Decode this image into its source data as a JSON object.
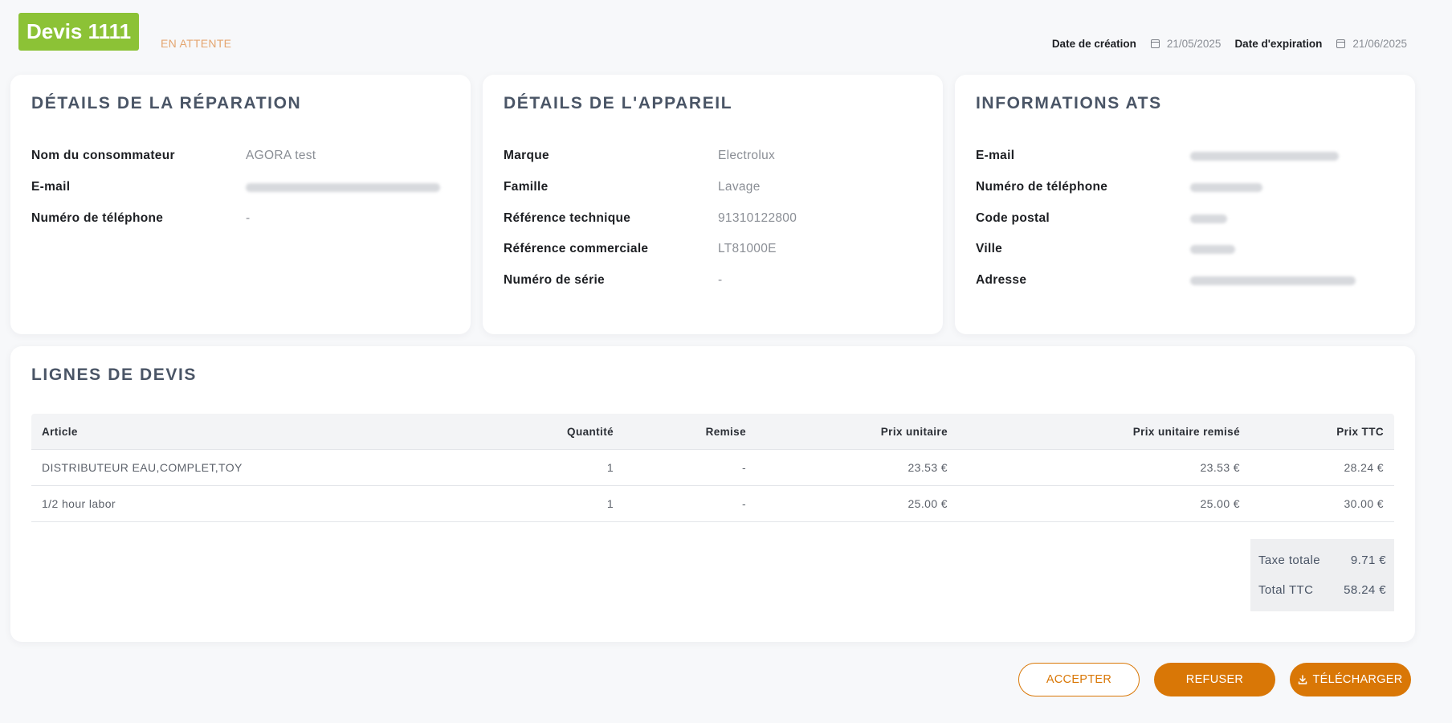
{
  "header": {
    "devis_title": "Devis 1111",
    "status": "EN ATTENTE",
    "creation_label": "Date de création",
    "creation_date": "21/05/2025",
    "expiration_label": "Date d'expiration",
    "expiration_date": "21/06/2025"
  },
  "repair": {
    "title": "DÉTAILS DE LA RÉPARATION",
    "rows": [
      {
        "label": "Nom du consommateur",
        "value": "AGORA test"
      },
      {
        "label": "E-mail",
        "value": ""
      },
      {
        "label": "Numéro de téléphone",
        "value": "-"
      }
    ]
  },
  "device": {
    "title": "DÉTAILS DE L'APPAREIL",
    "rows": [
      {
        "label": "Marque",
        "value": "Electrolux"
      },
      {
        "label": "Famille",
        "value": "Lavage"
      },
      {
        "label": "Référence technique",
        "value": "91310122800"
      },
      {
        "label": "Référence commerciale",
        "value": "LT81000E"
      },
      {
        "label": "Numéro de série",
        "value": "-"
      }
    ]
  },
  "ats": {
    "title": "INFORMATIONS ATS",
    "rows": [
      {
        "label": "E-mail",
        "value": ""
      },
      {
        "label": "Numéro de téléphone",
        "value": ""
      },
      {
        "label": "Code postal",
        "value": ""
      },
      {
        "label": "Ville",
        "value": ""
      },
      {
        "label": "Adresse",
        "value": ""
      }
    ]
  },
  "lines": {
    "title": "LIGNES DE DEVIS",
    "columns": [
      "Article",
      "Quantité",
      "Remise",
      "Prix unitaire",
      "Prix unitaire remisé",
      "Prix TTC"
    ],
    "rows": [
      [
        "DISTRIBUTEUR EAU,COMPLET,TOY",
        "1",
        "-",
        "23.53 €",
        "23.53 €",
        "28.24 €"
      ],
      [
        "1/2 hour labor",
        "1",
        "-",
        "25.00 €",
        "25.00 €",
        "30.00 €"
      ]
    ],
    "tax_label": "Taxe totale",
    "tax_value": "9.71 €",
    "total_label": "Total TTC",
    "total_value": "58.24 €"
  },
  "actions": {
    "accept": "ACCEPTER",
    "refuse": "REFUSER",
    "download": "TÉLÉCHARGER"
  },
  "colors": {
    "badge": "#8cc236",
    "status": "#e4a56f",
    "accent": "#d97706"
  }
}
